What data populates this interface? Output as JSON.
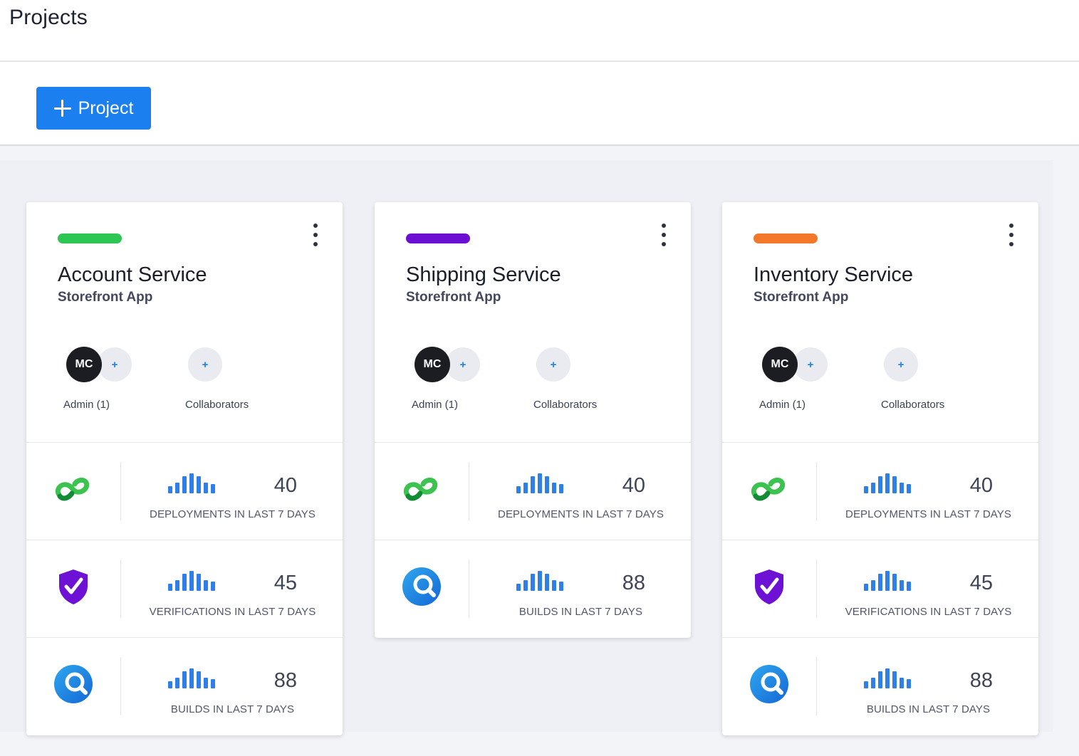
{
  "page": {
    "title": "Projects",
    "add_project_label": "Project"
  },
  "colors": {
    "primary": "#1b7ff0",
    "green": "#2dc653",
    "purple": "#6b0fd2",
    "orange": "#f3782a"
  },
  "sparkline": {
    "bar_levels": [
      0.35,
      0.55,
      0.85,
      1.0,
      0.85,
      0.55,
      0.45
    ]
  },
  "projects": [
    {
      "name": "Account Service",
      "app": "Storefront App",
      "color": "#2dc653",
      "admin_initials": "MC",
      "admin_label": "Admin (1)",
      "collaborators_label": "Collaborators",
      "add_symbol": "+",
      "metrics": [
        {
          "icon": "deployment-link-icon",
          "value": "40",
          "label": "DEPLOYMENTS IN LAST 7 DAYS"
        },
        {
          "icon": "verification-shield-icon",
          "value": "45",
          "label": "VERIFICATIONS IN LAST 7 DAYS"
        },
        {
          "icon": "build-search-icon",
          "value": "88",
          "label": "BUILDS IN LAST 7 DAYS"
        }
      ]
    },
    {
      "name": "Shipping Service",
      "app": "Storefront App",
      "color": "#6b0fd2",
      "admin_initials": "MC",
      "admin_label": "Admin (1)",
      "collaborators_label": "Collaborators",
      "add_symbol": "+",
      "metrics": [
        {
          "icon": "deployment-link-icon",
          "value": "40",
          "label": "DEPLOYMENTS IN LAST 7 DAYS"
        },
        {
          "icon": "build-search-icon",
          "value": "88",
          "label": "BUILDS IN LAST 7 DAYS"
        }
      ]
    },
    {
      "name": "Inventory Service",
      "app": "Storefront App",
      "color": "#f3782a",
      "admin_initials": "MC",
      "admin_label": "Admin (1)",
      "collaborators_label": "Collaborators",
      "add_symbol": "+",
      "metrics": [
        {
          "icon": "deployment-link-icon",
          "value": "40",
          "label": "DEPLOYMENTS IN LAST 7 DAYS"
        },
        {
          "icon": "verification-shield-icon",
          "value": "45",
          "label": "VERIFICATIONS IN LAST 7 DAYS"
        },
        {
          "icon": "build-search-icon",
          "value": "88",
          "label": "BUILDS IN LAST 7 DAYS"
        }
      ]
    }
  ]
}
